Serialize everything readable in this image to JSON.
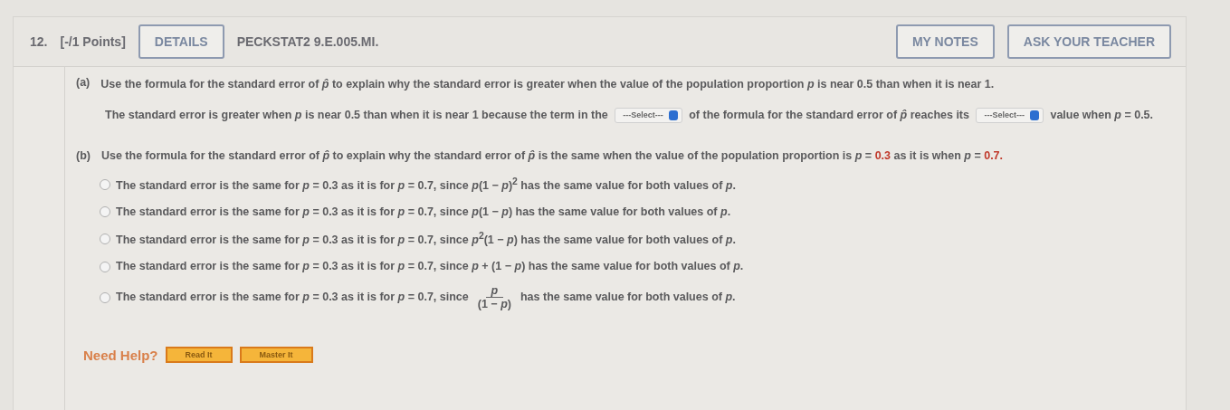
{
  "header": {
    "number": "12.",
    "points": "[-/1 Points]",
    "details_button": "DETAILS",
    "code": "PECKSTAT2 9.E.005.MI.",
    "buttons": [
      "MY NOTES",
      "ASK YOUR TEACHER"
    ]
  },
  "part_a": {
    "label": "(a)",
    "question": "Use the formula for the standard error of *p̂* to explain why the standard error is greater when the value of the population proportion *p* is near 0.5 than when it is near 1.",
    "answer_segments": [
      {
        "kind": "text",
        "text": "The standard error is greater when *p* is near 0.5 than when it is near 1 because the term in the"
      },
      {
        "kind": "select",
        "placeholder": "---Select---"
      },
      {
        "kind": "text",
        "text": "of the formula for the standard error of *p̂* reaches its"
      },
      {
        "kind": "select",
        "placeholder": "---Select---"
      },
      {
        "kind": "text",
        "text": "value when *p* = 0.5."
      }
    ]
  },
  "part_b": {
    "label": "(b)",
    "prompt_segments": [
      {
        "text": "Use the formula for the standard error of *p̂* to explain why the standard error of *p̂* is the same when the value of the population proportion is *p* =",
        "highlighted": false
      },
      {
        "text": "0.3",
        "highlighted": true
      },
      {
        "text": "as it is when *p* =",
        "highlighted": false
      },
      {
        "text": "0.7.",
        "highlighted": true
      }
    ],
    "options": [
      {
        "kind": "text",
        "text": "The standard error is the same for *p* = 0.3 as it is for *p* = 0.7, since *p*(1 − *p*)$^{2}$ has the same value for both values of *p*.",
        "selected": false
      },
      {
        "kind": "text",
        "text": "The standard error is the same for *p* = 0.3 as it is for *p* = 0.7, since *p*(1 − *p*) has the same value for both values of *p*.",
        "selected": false
      },
      {
        "kind": "text",
        "text": "The standard error is the same for *p* = 0.3 as it is for *p* = 0.7, since *p*$^{2}$(1 − *p*) has the same value for both values of *p*.",
        "selected": false
      },
      {
        "kind": "text",
        "text": "The standard error is the same for *p* = 0.3 as it is for *p* = 0.7, since *p* + (1 − *p*) has the same value for both values of *p*.",
        "selected": false
      },
      {
        "kind": "fraction",
        "before": "The standard error is the same for *p* = 0.3 as it is for *p* = 0.7, since",
        "numerator": "*p*",
        "denominator": "(1 − *p*)",
        "after": "has the same value for both values of *p*.",
        "selected": false
      }
    ]
  },
  "help": {
    "label": "Need Help?",
    "buttons": [
      "Read It",
      "Master It"
    ]
  }
}
